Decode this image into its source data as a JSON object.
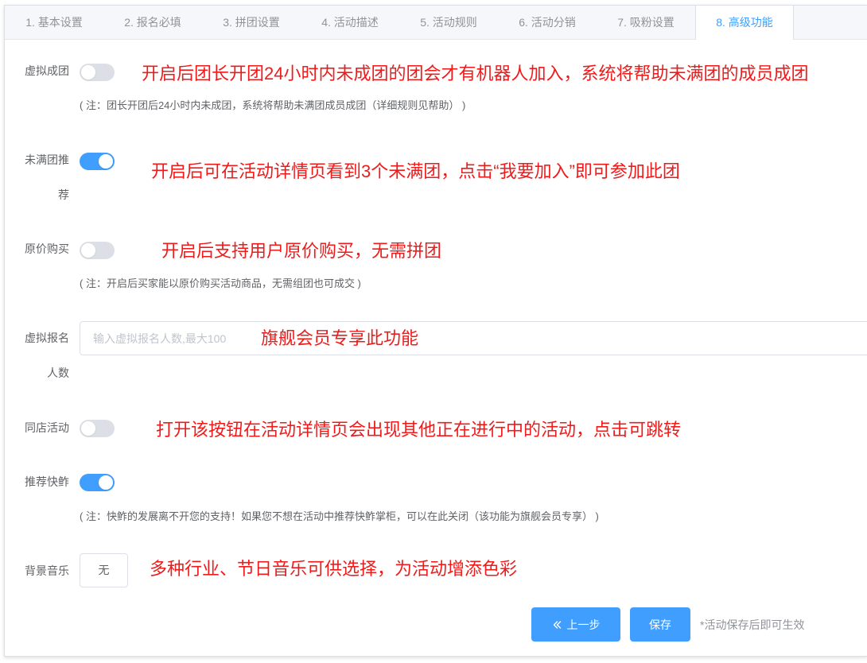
{
  "tabs": [
    {
      "label": "1. 基本设置",
      "active": false
    },
    {
      "label": "2. 报名必填",
      "active": false
    },
    {
      "label": "3. 拼团设置",
      "active": false
    },
    {
      "label": "4. 活动描述",
      "active": false
    },
    {
      "label": "5. 活动规则",
      "active": false
    },
    {
      "label": "6. 活动分销",
      "active": false
    },
    {
      "label": "7. 吸粉设置",
      "active": false
    },
    {
      "label": "8. 高级功能",
      "active": true
    }
  ],
  "form": {
    "virtual_group": {
      "label": "虚拟成团",
      "enabled": false,
      "annotation": "开启后团长开团24小时内未成团的团会才有机器人加入，系统将帮助未满团的成员成团",
      "note": "( 注：团长开团后24小时内未成团，系统将帮助未满团成员成团（详细规则见帮助） )"
    },
    "unfilled_group_recommend": {
      "label": "未满团推荐",
      "enabled": true,
      "annotation": "开启后可在活动详情页看到3个未满团，点击“我要加入”即可参加此团"
    },
    "original_price_purchase": {
      "label": "原价购买",
      "enabled": false,
      "annotation": "开启后支持用户原价购买，无需拼团",
      "note": "( 注：开启后买家能以原价购买活动商品，无需组团也可成交 )"
    },
    "virtual_signup_count": {
      "label": "虚拟报名人数",
      "value": "",
      "placeholder": "输入虚拟报名人数,最大100",
      "annotation": "旗舰会员专享此功能"
    },
    "same_store_activities": {
      "label": "同店活动",
      "enabled": false,
      "annotation": "打开该按钮在活动详情页会出现其他正在进行中的活动，点击可跳转"
    },
    "recommend_kuaizha": {
      "label": "推荐快鲊",
      "enabled": true,
      "note": "( 注：快鲊的发展离不开您的支持！如果您不想在活动中推荐快鲊掌柜，可以在此关闭（该功能为旗舰会员专享） )"
    },
    "background_music": {
      "label": "背景音乐",
      "selected": "无",
      "annotation": "多种行业、节日音乐可供选择，为活动增添色彩"
    }
  },
  "actions": {
    "prev_icon": "double-chevron-left-icon",
    "prev_label": "上一步",
    "save_label": "保存",
    "hint": "*活动保存后即可生效"
  },
  "colors": {
    "accent": "#409eff",
    "annotation": "#ef1a1a",
    "switch_off": "#dcdfe6"
  }
}
